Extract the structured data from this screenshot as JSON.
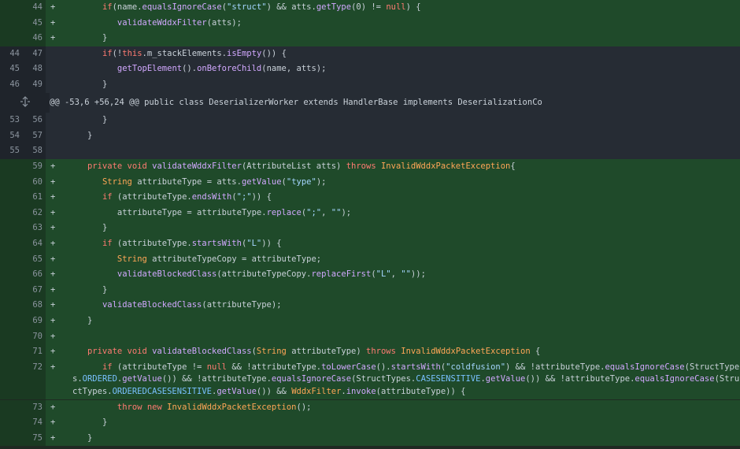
{
  "hunk_header": "@@ -53,6 +56,24 @@ public class DeserializerWorker extends HandlerBase implements DeserializationCo",
  "lines": [
    {
      "old": "",
      "new": "44",
      "type": "add",
      "marker": "+",
      "indent": 6,
      "segs": [
        [
          "kw",
          "if"
        ],
        [
          "",
          "("
        ],
        [
          "",
          "name."
        ],
        [
          "fn",
          "equalsIgnoreCase"
        ],
        [
          "",
          "("
        ],
        [
          "str",
          "\"struct\""
        ],
        [
          "",
          ") && atts."
        ],
        [
          "fn",
          "getType"
        ],
        [
          "",
          "(0) != "
        ],
        [
          "kw",
          "null"
        ],
        [
          "",
          ") {"
        ]
      ]
    },
    {
      "old": "",
      "new": "45",
      "type": "add",
      "marker": "+",
      "indent": 9,
      "segs": [
        [
          "fn",
          "validateWddxFilter"
        ],
        [
          "",
          "(atts);"
        ]
      ]
    },
    {
      "old": "",
      "new": "46",
      "type": "add",
      "marker": "+",
      "indent": 6,
      "segs": [
        [
          "",
          "}"
        ]
      ]
    },
    {
      "old": "44",
      "new": "47",
      "type": "ctx",
      "marker": "",
      "indent": 6,
      "segs": [
        [
          "kw",
          "if"
        ],
        [
          "",
          "(!"
        ],
        [
          "kw",
          "this"
        ],
        [
          "",
          ".m_stackElements."
        ],
        [
          "fn",
          "isEmpty"
        ],
        [
          "",
          "()) {"
        ]
      ]
    },
    {
      "old": "45",
      "new": "48",
      "type": "ctx",
      "marker": "",
      "indent": 9,
      "segs": [
        [
          "fn",
          "getTopElement"
        ],
        [
          "",
          "()."
        ],
        [
          "fn",
          "onBeforeChild"
        ],
        [
          "",
          "(name, atts);"
        ]
      ]
    },
    {
      "old": "46",
      "new": "49",
      "type": "ctx",
      "marker": "",
      "indent": 6,
      "segs": [
        [
          "",
          "}"
        ]
      ]
    },
    {
      "old": "53",
      "new": "56",
      "type": "ctx",
      "marker": "",
      "indent": 6,
      "segs": [
        [
          "",
          "}"
        ]
      ]
    },
    {
      "old": "54",
      "new": "57",
      "type": "ctx",
      "marker": "",
      "indent": 3,
      "segs": [
        [
          "",
          "}"
        ]
      ]
    },
    {
      "old": "55",
      "new": "58",
      "type": "ctx",
      "marker": "",
      "indent": 0,
      "segs": []
    },
    {
      "old": "",
      "new": "59",
      "type": "add",
      "marker": "+",
      "indent": 3,
      "segs": [
        [
          "kw",
          "private void "
        ],
        [
          "fn",
          "validateWddxFilter"
        ],
        [
          "",
          "(AttributeList atts) "
        ],
        [
          "kw",
          "throws "
        ],
        [
          "ty",
          "InvalidWddxPacketException"
        ],
        [
          "",
          ""
        ],
        [
          "",
          ""
        ],
        [
          "",
          "{"
        ]
      ]
    },
    {
      "old": "",
      "new": "60",
      "type": "add",
      "marker": "+",
      "indent": 6,
      "segs": [
        [
          "ty",
          "String "
        ],
        [
          "",
          "attributeType = atts."
        ],
        [
          "fn",
          "getValue"
        ],
        [
          "",
          "("
        ],
        [
          "str",
          "\"type\""
        ],
        [
          "",
          ");"
        ]
      ]
    },
    {
      "old": "",
      "new": "61",
      "type": "add",
      "marker": "+",
      "indent": 6,
      "segs": [
        [
          "kw",
          "if "
        ],
        [
          "",
          "(attributeType."
        ],
        [
          "fn",
          "endsWith"
        ],
        [
          "",
          "("
        ],
        [
          "str",
          "\";\""
        ],
        [
          "",
          ")) {"
        ]
      ]
    },
    {
      "old": "",
      "new": "62",
      "type": "add",
      "marker": "+",
      "indent": 9,
      "segs": [
        [
          "",
          "attributeType = attributeType."
        ],
        [
          "fn",
          "replace"
        ],
        [
          "",
          "("
        ],
        [
          "str",
          "\";\""
        ],
        [
          "",
          ", "
        ],
        [
          "str",
          "\"\""
        ],
        [
          "",
          ");"
        ]
      ]
    },
    {
      "old": "",
      "new": "63",
      "type": "add",
      "marker": "+",
      "indent": 6,
      "segs": [
        [
          "",
          "}"
        ]
      ]
    },
    {
      "old": "",
      "new": "64",
      "type": "add",
      "marker": "+",
      "indent": 6,
      "segs": [
        [
          "kw",
          "if "
        ],
        [
          "",
          "(attributeType."
        ],
        [
          "fn",
          "startsWith"
        ],
        [
          "",
          "("
        ],
        [
          "str",
          "\"L\""
        ],
        [
          "",
          ")) {"
        ]
      ]
    },
    {
      "old": "",
      "new": "65",
      "type": "add",
      "marker": "+",
      "indent": 9,
      "segs": [
        [
          "ty",
          "String "
        ],
        [
          "",
          "attributeTypeCopy = attributeType;"
        ]
      ]
    },
    {
      "old": "",
      "new": "66",
      "type": "add",
      "marker": "+",
      "indent": 9,
      "segs": [
        [
          "fn",
          "validateBlockedClass"
        ],
        [
          "",
          "(attributeTypeCopy."
        ],
        [
          "fn",
          "replaceFirst"
        ],
        [
          "",
          "("
        ],
        [
          "str",
          "\"L\""
        ],
        [
          "",
          ", "
        ],
        [
          "str",
          "\"\""
        ],
        [
          "",
          "));"
        ]
      ]
    },
    {
      "old": "",
      "new": "67",
      "type": "add",
      "marker": "+",
      "indent": 6,
      "segs": [
        [
          "",
          "}"
        ]
      ]
    },
    {
      "old": "",
      "new": "68",
      "type": "add",
      "marker": "+",
      "indent": 6,
      "segs": [
        [
          "fn",
          "validateBlockedClass"
        ],
        [
          "",
          "(attributeType);"
        ]
      ]
    },
    {
      "old": "",
      "new": "69",
      "type": "add",
      "marker": "+",
      "indent": 3,
      "segs": [
        [
          "",
          "}"
        ]
      ]
    },
    {
      "old": "",
      "new": "70",
      "type": "add",
      "marker": "+",
      "indent": 0,
      "segs": []
    },
    {
      "old": "",
      "new": "71",
      "type": "add",
      "marker": "+",
      "indent": 3,
      "segs": [
        [
          "kw",
          "private void "
        ],
        [
          "fn",
          "validateBlockedClass"
        ],
        [
          "",
          "("
        ],
        [
          "ty",
          "String "
        ],
        [
          "",
          "attributeType) "
        ],
        [
          "kw",
          "throws "
        ],
        [
          "ty",
          "InvalidWddxPacketException "
        ],
        [
          "",
          "{"
        ]
      ]
    },
    {
      "old": "",
      "new": "72",
      "type": "add",
      "marker": "+",
      "indent": 6,
      "wrap": true,
      "segs": [
        [
          "kw",
          "if "
        ],
        [
          "",
          "(attributeType != "
        ],
        [
          "kw",
          "null "
        ],
        [
          "",
          "&& !attributeType."
        ],
        [
          "fn",
          "toLowerCase"
        ],
        [
          "",
          "()."
        ],
        [
          "fn",
          "startsWith"
        ],
        [
          "",
          "("
        ],
        [
          "str",
          "\"coldfusion\""
        ],
        [
          "",
          ") && !attributeType."
        ],
        [
          "fn",
          "equalsIgnoreCase"
        ],
        [
          "",
          "(StructTypes."
        ],
        [
          "cn",
          "ORDERED"
        ],
        [
          "",
          "."
        ],
        [
          "fn",
          "getValue"
        ],
        [
          "",
          "()) && !attributeType."
        ],
        [
          "fn",
          "equalsIgnoreCase"
        ],
        [
          "",
          "(StructTypes."
        ],
        [
          "cn",
          "CASESENSITIVE"
        ],
        [
          "",
          "."
        ],
        [
          "fn",
          "getValue"
        ],
        [
          "",
          "()) && !attributeType."
        ],
        [
          "fn",
          "equalsIgnoreCase"
        ],
        [
          "",
          "(StructTypes."
        ],
        [
          "cn",
          "ORDEREDCASESENSITIVE"
        ],
        [
          "",
          "."
        ],
        [
          "fn",
          "getValue"
        ],
        [
          "",
          "()) && "
        ],
        [
          "ty",
          "WddxFilter"
        ],
        [
          "",
          "."
        ],
        [
          "fn",
          "invoke"
        ],
        [
          "",
          "(attributeType)) {"
        ]
      ]
    },
    {
      "old": "",
      "new": "73",
      "type": "add",
      "marker": "+",
      "indent": 9,
      "segs": [
        [
          "kw",
          "throw new "
        ],
        [
          "ty",
          "InvalidWddxPacketException"
        ],
        [
          "",
          "();"
        ]
      ]
    },
    {
      "old": "",
      "new": "74",
      "type": "add",
      "marker": "+",
      "indent": 6,
      "segs": [
        [
          "",
          "}"
        ]
      ]
    },
    {
      "old": "",
      "new": "75",
      "type": "add",
      "marker": "+",
      "indent": 3,
      "segs": [
        [
          "",
          "}"
        ]
      ]
    }
  ]
}
